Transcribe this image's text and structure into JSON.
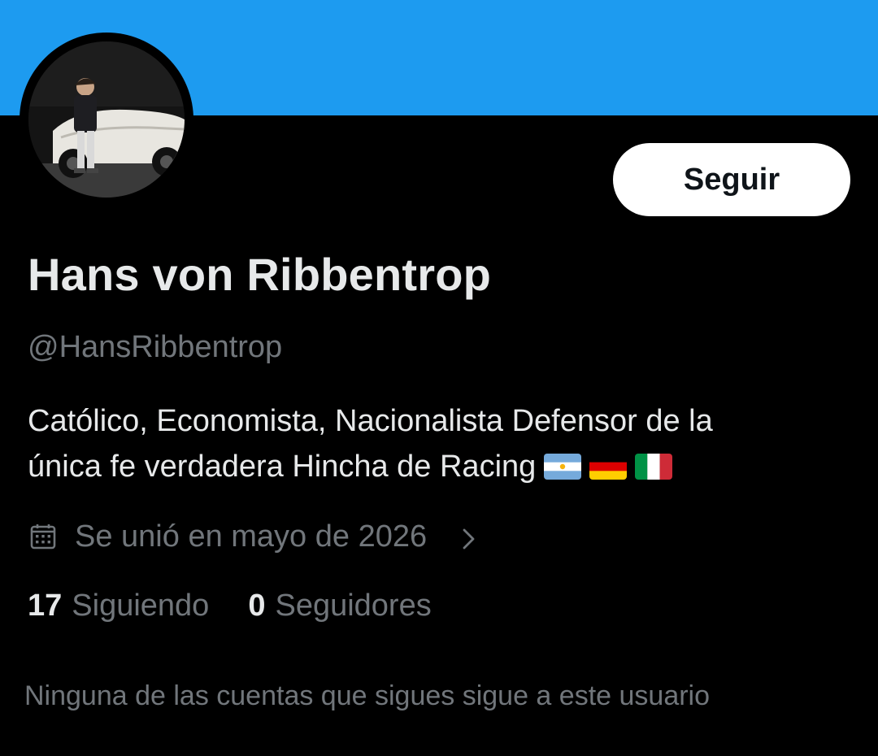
{
  "profile": {
    "display_name": "Hans von Ribbentrop",
    "handle": "@HansRibbentrop",
    "bio_line1": "Católico, Economista, Nacionalista Defensor de la",
    "bio_line2": "única fe verdadera Hincha de Racing",
    "bio_flags": [
      "flag-argentina-icon",
      "flag-germany-icon",
      "flag-italy-icon"
    ],
    "joined": "Se unió en mayo de 2026"
  },
  "actions": {
    "follow_label": "Seguir"
  },
  "stats": {
    "following_count": "17",
    "following_label": "Siguiendo",
    "followers_count": "0",
    "followers_label": "Seguidores"
  },
  "mutuals_text": "Ninguna de las cuentas que sigues sigue a este usuario",
  "colors": {
    "banner": "#1d9bf0",
    "background": "#000000",
    "primary_text": "#e7e9ea",
    "secondary_text": "#71767b",
    "button_bg": "#ffffff",
    "button_text": "#0f1419"
  }
}
